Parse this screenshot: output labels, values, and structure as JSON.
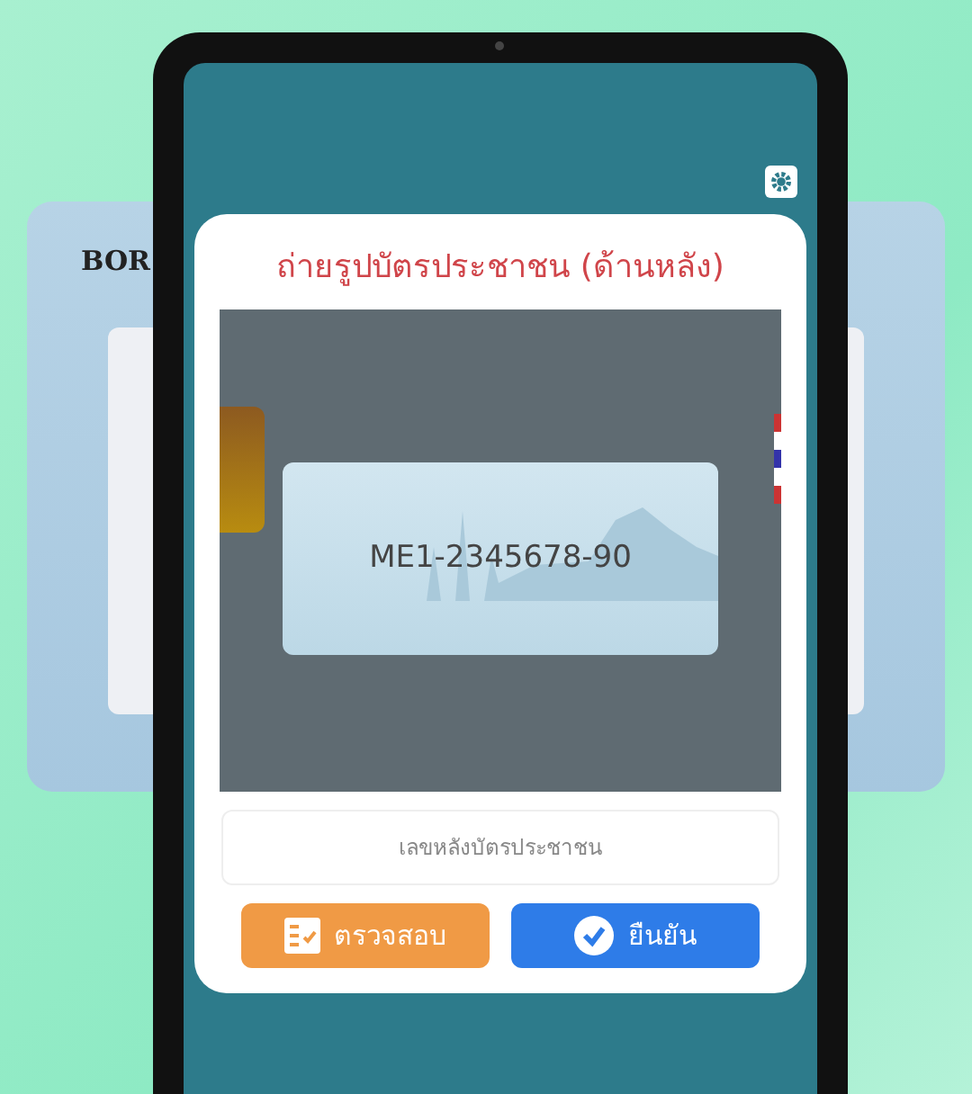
{
  "background_card": {
    "title": "BOR"
  },
  "dialog": {
    "title": "ถ่ายรูปบัตรประชาชน (ด้านหลัง)",
    "card_number": "ME1-2345678-90",
    "field": {
      "placeholder": "เลขหลังบัตรประชาชน"
    },
    "buttons": [
      {
        "kind": "check",
        "label": "ตรวจสอบ"
      },
      {
        "kind": "confirm",
        "label": "ยืนยัน"
      }
    ]
  }
}
